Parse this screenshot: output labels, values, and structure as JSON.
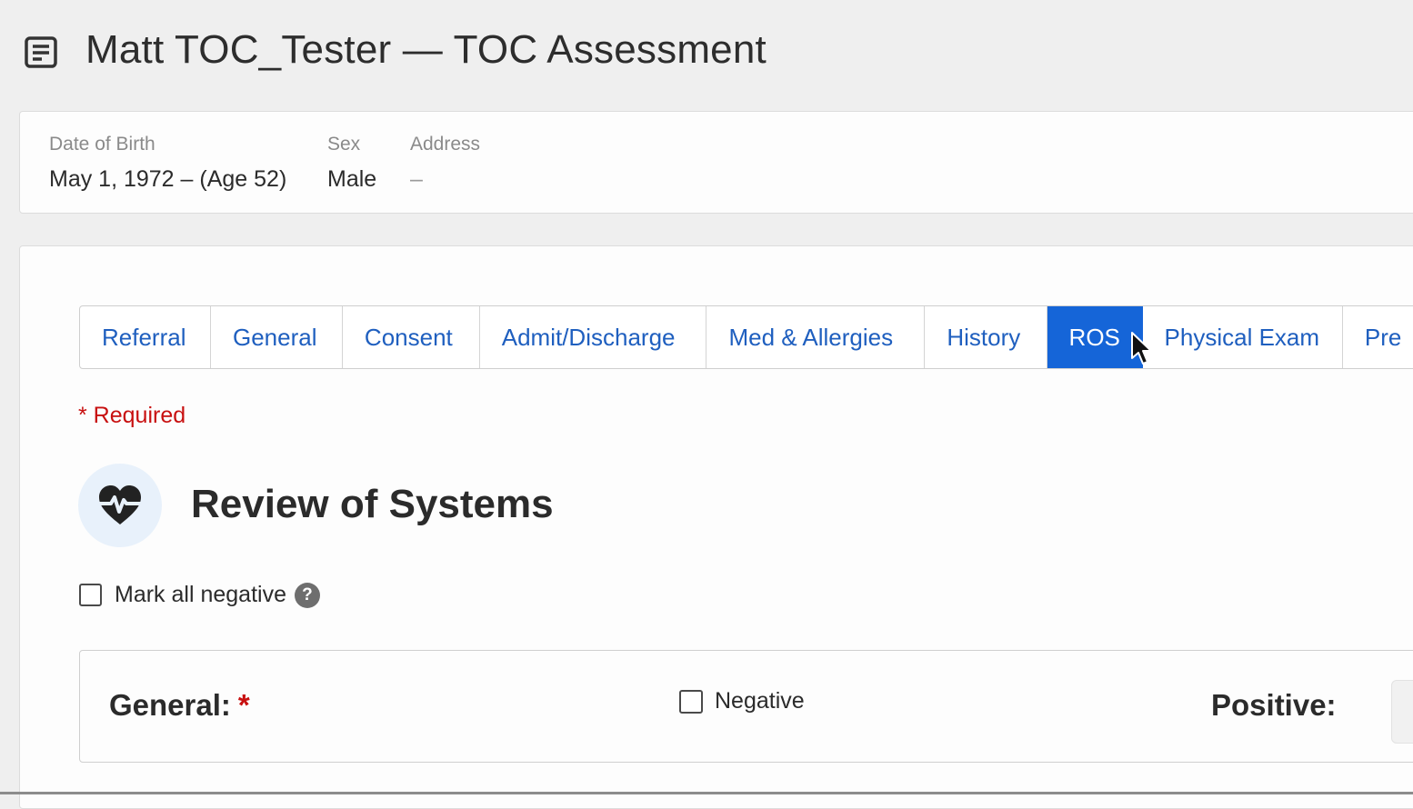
{
  "header": {
    "icon": "document-icon",
    "title": "Matt TOC_Tester — TOC Assessment"
  },
  "patient": {
    "dob_label": "Date of Birth",
    "dob_value": "May 1, 1972 – (Age 52)",
    "sex_label": "Sex",
    "sex_value": "Male",
    "address_label": "Address",
    "address_value": "–"
  },
  "tabs": [
    {
      "label": "Referral",
      "active": false
    },
    {
      "label": "General",
      "active": false
    },
    {
      "label": "Consent",
      "active": false
    },
    {
      "label": "Admit/Discharge",
      "active": false
    },
    {
      "label": "Med & Allergies",
      "active": false
    },
    {
      "label": "History",
      "active": false
    },
    {
      "label": "ROS",
      "active": true
    },
    {
      "label": "Physical Exam",
      "active": false
    },
    {
      "label": "Pre",
      "active": false
    }
  ],
  "colors": {
    "accent": "#1565d8",
    "required": "#c81010"
  },
  "required_note": "* Required",
  "section": {
    "icon": "heart-pulse-icon",
    "title": "Review of Systems"
  },
  "mark_all": {
    "label": "Mark all negative",
    "checked": false,
    "help_icon": "question-circle-icon",
    "help_glyph": "?"
  },
  "systems": [
    {
      "label": "General:",
      "required_star": "*",
      "negative_label": "Negative",
      "negative_checked": false,
      "positive_label": "Positive:"
    }
  ]
}
